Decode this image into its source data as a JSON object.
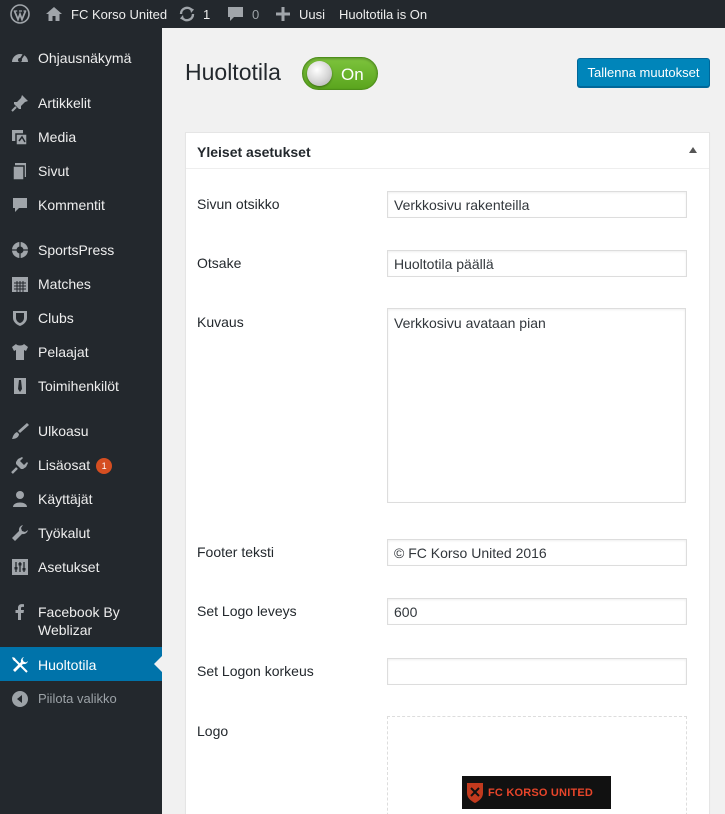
{
  "adminbar": {
    "site_name": "FC Korso United",
    "updates_count": "1",
    "comments_count": "0",
    "new_label": "Uusi",
    "maintenance_status": "Huoltotila is On"
  },
  "sidebar": {
    "items": [
      {
        "label": "Ohjausnäkymä",
        "icon": "dashboard-icon"
      },
      {
        "label": "Artikkelit",
        "icon": "pin-icon"
      },
      {
        "label": "Media",
        "icon": "media-icon"
      },
      {
        "label": "Sivut",
        "icon": "pages-icon"
      },
      {
        "label": "Kommentit",
        "icon": "comment-icon"
      },
      {
        "label": "SportsPress",
        "icon": "sportspress-icon"
      },
      {
        "label": "Matches",
        "icon": "calendar-icon"
      },
      {
        "label": "Clubs",
        "icon": "shield-icon"
      },
      {
        "label": "Pelaajat",
        "icon": "shirt-icon"
      },
      {
        "label": "Toimihenkilöt",
        "icon": "tie-icon"
      },
      {
        "label": "Ulkoasu",
        "icon": "brush-icon"
      },
      {
        "label": "Lisäosat",
        "icon": "plugin-icon",
        "badge": "1"
      },
      {
        "label": "Käyttäjät",
        "icon": "user-icon"
      },
      {
        "label": "Työkalut",
        "icon": "wrench-icon"
      },
      {
        "label": "Asetukset",
        "icon": "settings-icon"
      },
      {
        "label_line1": "Facebook By",
        "label_line2": "Weblizar",
        "icon": "facebook-icon"
      },
      {
        "label": "Huoltotila",
        "icon": "tools-icon",
        "current": true
      },
      {
        "label": "Piilota valikko",
        "icon": "collapse-icon"
      }
    ]
  },
  "page": {
    "title": "Huoltotila",
    "toggle_label": "On",
    "toggle_state": "on",
    "save_button": "Tallenna muutokset"
  },
  "postbox": {
    "title": "Yleiset asetukset",
    "fields": {
      "site_title": {
        "label": "Sivun otsikko",
        "value": "Verkkosivu rakenteilla"
      },
      "heading": {
        "label": "Otsake",
        "value": "Huoltotila päällä"
      },
      "description": {
        "label": "Kuvaus",
        "value": "Verkkosivu avataan pian"
      },
      "footer_text": {
        "label": "Footer teksti",
        "value": "© FC Korso United 2016"
      },
      "logo_width": {
        "label": "Set Logo leveys",
        "value": "600"
      },
      "logo_height": {
        "label": "Set Logon korkeus",
        "value": ""
      },
      "logo": {
        "label": "Logo",
        "image_text": "FC KORSO UNITED"
      }
    }
  },
  "colors": {
    "adminbar_bg": "#23282d",
    "sidebar_bg": "#23282d",
    "current_menu": "#0073aa",
    "primary_button": "#0085ba",
    "toggle_on": "#6ab42a",
    "badge": "#d54e21"
  }
}
